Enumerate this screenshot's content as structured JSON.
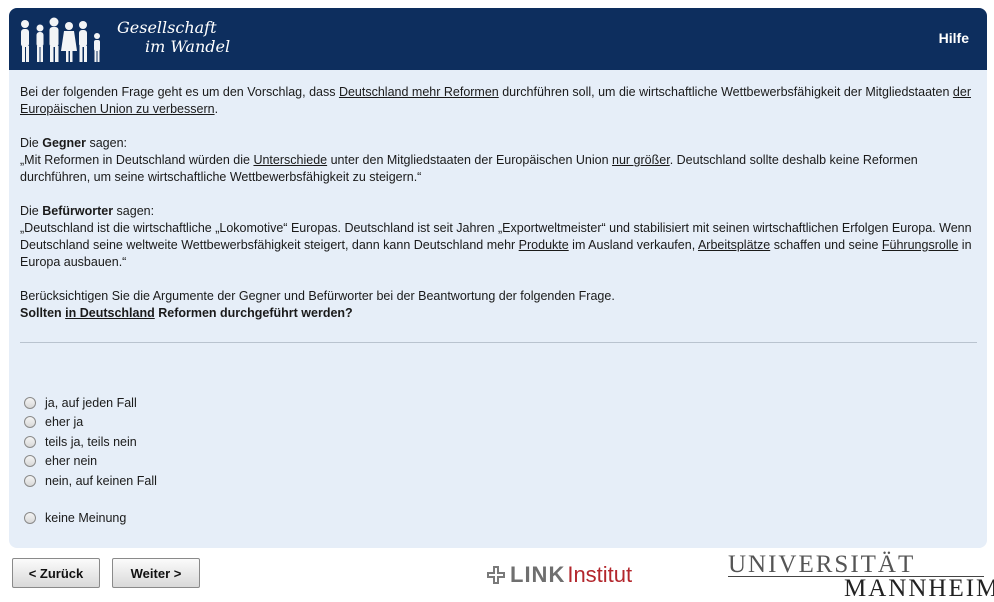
{
  "header": {
    "logo_line1": "Gesellschaft",
    "logo_line2": "im Wandel",
    "help_label": "Hilfe"
  },
  "intro": {
    "t1": "Bei der folgenden Frage geht es um den Vorschlag, dass ",
    "link1": "Deutschland mehr Reformen",
    "t2": " durchführen soll, um die wirtschaftliche Wettbewerbsfähigkeit der Mitgliedstaaten ",
    "link2": "der Europäischen Union zu verbessern",
    "t3": "."
  },
  "opponents": {
    "label_pre": "Die ",
    "label_bold": "Gegner",
    "label_post": " sagen:",
    "t1": "„Mit Reformen in Deutschland würden die ",
    "link1": "Unterschiede",
    "t2": " unter den Mitgliedstaaten der Europäischen Union ",
    "link2": "nur größer",
    "t3": ". Deutschland sollte deshalb keine Reformen durchführen, um seine wirtschaftliche Wettbewerbsfähigkeit zu steigern.“"
  },
  "supporters": {
    "label_pre": "Die ",
    "label_bold": "Befürworter",
    "label_post": " sagen:",
    "t1": "„Deutschland ist die wirtschaftliche „Lokomotive“ Europas. Deutschland ist seit Jahren „Exportweltmeister“ und stabilisiert mit seinen wirtschaftlichen Erfolgen Europa. Wenn Deutschland seine weltweite Wettbewerbsfähigkeit steigert, dann kann Deutschland mehr ",
    "link1": "Produkte",
    "t2": " im Ausland verkaufen, ",
    "link2": "Arbeitsplätze",
    "t3": " schaffen und seine ",
    "link3": "Führungsrolle",
    "t4": " in Europa ausbauen.“"
  },
  "instruction": "Berücksichtigen Sie die Argumente der Gegner und Befürworter bei der Beantwortung der folgenden Frage.",
  "question": {
    "pre": "Sollten ",
    "link": "in Deutschland",
    "post": " Reformen durchgeführt werden?"
  },
  "options": [
    "ja, auf jeden Fall",
    "eher ja",
    "teils ja, teils nein",
    "eher nein",
    "nein, auf keinen Fall",
    "keine Meinung"
  ],
  "nav": {
    "back_label": "< Zurück",
    "next_label": "Weiter >"
  },
  "logos": {
    "link_word1": "LINK",
    "link_word2": "Institut",
    "uni_line1": "UNIVERSITÄT",
    "uni_line2": "MANNHEIM"
  },
  "colors": {
    "header_bg": "#0d2e5e",
    "panel_bg": "#e6eef8",
    "link_red": "#b3262c"
  }
}
